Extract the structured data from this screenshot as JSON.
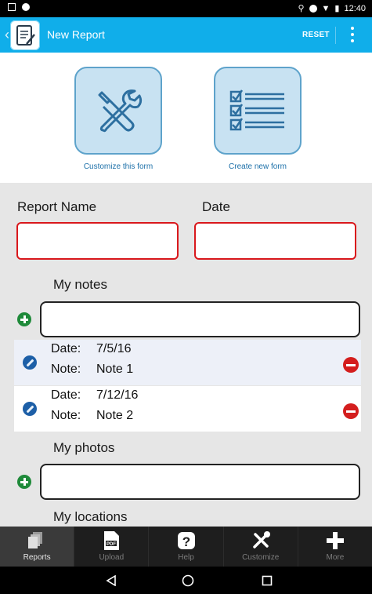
{
  "status_bar": {
    "time": "12:40"
  },
  "app_bar": {
    "title": "New Report",
    "reset_label": "RESET"
  },
  "hero": {
    "customize_label": "Customize this form",
    "create_label": "Create new form"
  },
  "form": {
    "report_name_label": "Report Name",
    "date_label": "Date",
    "report_name_value": "",
    "date_value": ""
  },
  "notes": {
    "title": "My notes",
    "input_value": "",
    "items": [
      {
        "date_label": "Date:",
        "date": "7/5/16",
        "note_label": "Note:",
        "note": "Note 1"
      },
      {
        "date_label": "Date:",
        "date": "7/12/16",
        "note_label": "Note:",
        "note": "Note 2"
      }
    ]
  },
  "photos": {
    "title": "My photos",
    "input_value": ""
  },
  "locations": {
    "title": "My locations"
  },
  "tabs": [
    {
      "label": "Reports",
      "icon": "reports-icon",
      "active": true
    },
    {
      "label": "Upload",
      "icon": "pdf-icon",
      "active": false
    },
    {
      "label": "Help",
      "icon": "help-icon",
      "active": false
    },
    {
      "label": "Customize",
      "icon": "tools-icon",
      "active": false
    },
    {
      "label": "More",
      "icon": "plus-icon",
      "active": false
    }
  ],
  "colors": {
    "app_bar": "#10aeea",
    "required_border": "#d9181c",
    "add_button": "#1f8a3a",
    "delete_button": "#d41e1e",
    "edit_button": "#1d5fa7",
    "tile_fill": "#c8e2f2"
  }
}
